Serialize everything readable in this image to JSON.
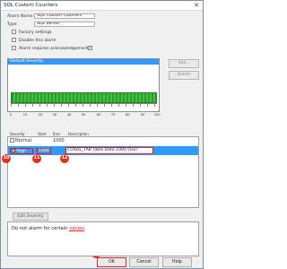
{
  "window": {
    "title": "SQL Custom Counters",
    "close_glyph": "✕"
  },
  "form": {
    "alarm_name_label": "Alarm Name",
    "alarm_name_value": "SQL Custom Counters",
    "type_label": "Type",
    "type_value": "SQL Server",
    "factory_settings_label": "Factory settings",
    "disable_alarm_label": "Disable this alarm",
    "requires_ack_label": "Alarm requires acknowledgement",
    "help_glyph": "?"
  },
  "severity_list": {
    "selected_item": "Default Severity"
  },
  "side_buttons": {
    "add_label": "Add...",
    "delete_label": "Delete"
  },
  "slider": {
    "ticks": [
      "0",
      "10",
      "20",
      "30",
      "40",
      "50",
      "60",
      "70",
      "80",
      "90",
      "100"
    ]
  },
  "grid": {
    "headers": {
      "severity": "Severity",
      "start": "Start",
      "end": "End",
      "description": "Description"
    },
    "normal": {
      "severity": "Normal",
      "end": "1000"
    },
    "high": {
      "severity": "High",
      "start": "1000",
      "description": "COSOL_TAB Table Data 1000 Over"
    }
  },
  "badges": {
    "b10": "10",
    "b11": "11",
    "b12": "12",
    "b13": "13"
  },
  "tab": {
    "label": "Edit Severity"
  },
  "note": {
    "prefix": "Do not alarm for certain ",
    "link": "values",
    "suffix": "."
  },
  "buttons": {
    "ok": "OK",
    "cancel": "Cancel",
    "help": "Help"
  },
  "colors": {
    "selection": "#3399ff",
    "highlight_red": "#dd2222",
    "badge_red": "#e0321f",
    "slider_green": "#3fc43f"
  }
}
